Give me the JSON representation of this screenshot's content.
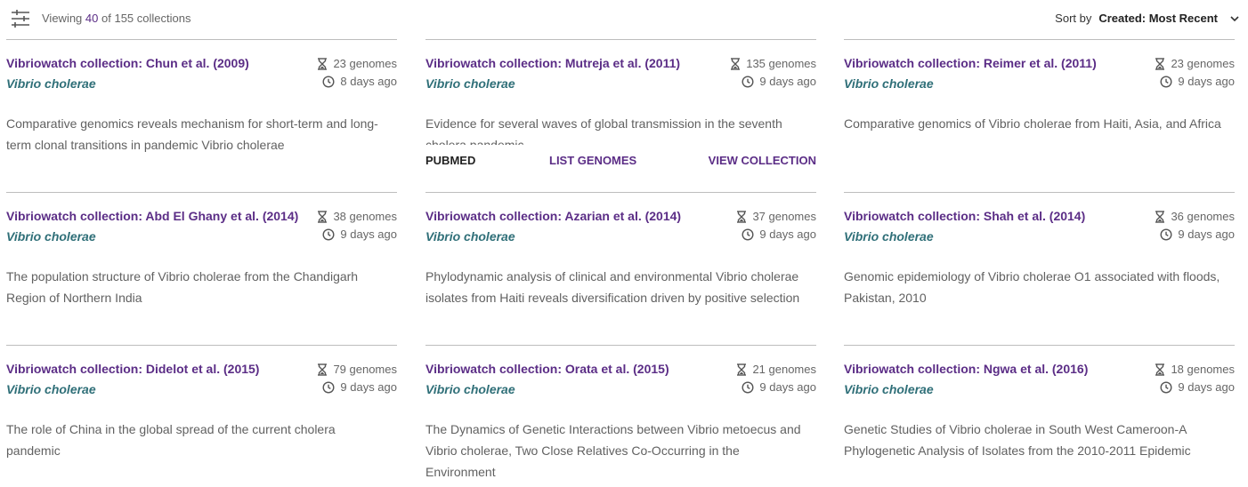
{
  "toolbar": {
    "icon": "filter-sliders-icon",
    "viewing_prefix": "Viewing",
    "viewing_count": "40",
    "viewing_suffix": "of 155 collections",
    "sort_label": "Sort by",
    "sort_value": "Created: Most Recent"
  },
  "colors": {
    "title": "#5b2d86",
    "species": "#2f6f78",
    "divider": "#bdbdbd"
  },
  "cards": [
    {
      "title": "Vibriowatch collection: Chun et al. (2009)",
      "species": "Vibrio cholerae",
      "genomes": "23 genomes",
      "age": "8 days ago",
      "description": "Comparative genomics reveals mechanism for short-term and long-term clonal transitions in pandemic Vibrio cholerae"
    },
    {
      "title": "Vibriowatch collection: Mutreja et al. (2011)",
      "species": "Vibrio cholerae",
      "genomes": "135 genomes",
      "age": "9 days ago",
      "description": "Evidence for several waves of global transmission in the seventh cholera pandemic",
      "actions": {
        "pubmed": "PUBMED",
        "list": "LIST GENOMES",
        "view": "VIEW COLLECTION"
      }
    },
    {
      "title": "Vibriowatch collection: Reimer et al. (2011)",
      "species": "Vibrio cholerae",
      "genomes": "23 genomes",
      "age": "9 days ago",
      "description": "Comparative genomics of Vibrio cholerae from Haiti, Asia, and Africa"
    },
    {
      "title": "Vibriowatch collection: Abd El Ghany et al. (2014)",
      "species": "Vibrio cholerae",
      "genomes": "38 genomes",
      "age": "9 days ago",
      "description": "The population structure of Vibrio cholerae from the Chandigarh Region of Northern India"
    },
    {
      "title": "Vibriowatch collection: Azarian et al. (2014)",
      "species": "Vibrio cholerae",
      "genomes": "37 genomes",
      "age": "9 days ago",
      "description": "Phylodynamic analysis of clinical and environmental Vibrio cholerae isolates from Haiti reveals diversification driven by positive selection"
    },
    {
      "title": "Vibriowatch collection: Shah et al. (2014)",
      "species": "Vibrio cholerae",
      "genomes": "36 genomes",
      "age": "9 days ago",
      "description": "Genomic epidemiology of Vibrio cholerae O1 associated with floods, Pakistan, 2010"
    },
    {
      "title": "Vibriowatch collection: Didelot et al. (2015)",
      "species": "Vibrio cholerae",
      "genomes": "79 genomes",
      "age": "9 days ago",
      "description": "The role of China in the global spread of the current cholera pandemic"
    },
    {
      "title": "Vibriowatch collection: Orata et al. (2015)",
      "species": "Vibrio cholerae",
      "genomes": "21 genomes",
      "age": "9 days ago",
      "description": "The Dynamics of Genetic Interactions between Vibrio metoecus and Vibrio cholerae, Two Close Relatives Co-Occurring in the Environment"
    },
    {
      "title": "Vibriowatch collection: Ngwa et al. (2016)",
      "species": "Vibrio cholerae",
      "genomes": "18 genomes",
      "age": "9 days ago",
      "description": "Genetic Studies of Vibrio cholerae in South West Cameroon-A Phylogenetic Analysis of Isolates from the 2010-2011 Epidemic"
    }
  ]
}
